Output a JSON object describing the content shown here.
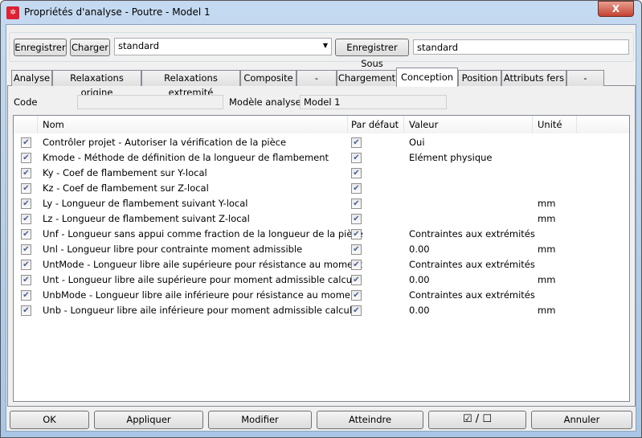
{
  "window": {
    "title": "Propriétés d'analyse - Poutre - Model 1",
    "close": "X"
  },
  "toolbar": {
    "save": "Enregistrer",
    "load": "Charger",
    "preset": "standard",
    "save_as": "Enregistrer Sous",
    "save_as_name": "standard"
  },
  "tabs": [
    "Analyse",
    "Relaxations origine",
    "Relaxations extremité",
    "Composite",
    "-",
    "Chargement",
    "Conception",
    "Position",
    "Attributs fers",
    "-"
  ],
  "selected_tab": "Conception",
  "form": {
    "code_label": "Code",
    "code_value": "",
    "model_label": "Modèle analyse",
    "model_value": "Model 1"
  },
  "table": {
    "headers": [
      "Nom",
      "Par défaut",
      "Valeur",
      "Unité"
    ],
    "rows": [
      {
        "checked": true,
        "name": "Contrôler projet - Autoriser la vérification de la pièce",
        "default": true,
        "value": "Oui",
        "unit": ""
      },
      {
        "checked": true,
        "name": "Kmode - Méthode de définition de la longueur de flambement",
        "default": true,
        "value": "Elément physique",
        "unit": ""
      },
      {
        "checked": true,
        "name": "Ky - Coef de flambement sur Y-local",
        "default": true,
        "value": "",
        "unit": ""
      },
      {
        "checked": true,
        "name": "Kz - Coef de flambement sur Z-local",
        "default": true,
        "value": "",
        "unit": ""
      },
      {
        "checked": true,
        "name": "Ly - Longueur de flambement suivant Y-local",
        "default": true,
        "value": "",
        "unit": "mm"
      },
      {
        "checked": true,
        "name": "Lz - Longueur de flambement suivant Z-local",
        "default": true,
        "value": "",
        "unit": "mm"
      },
      {
        "checked": true,
        "name": "Unf - Longueur sans appui comme fraction de la longueur de la pièce",
        "default": true,
        "value": "Contraintes aux extrémités",
        "unit": ""
      },
      {
        "checked": true,
        "name": "Unl - Longueur libre pour contrainte moment admissible",
        "default": true,
        "value": "0.00",
        "unit": "mm"
      },
      {
        "checked": true,
        "name": "UntMode - Longueur libre aile supérieure pour résistance au moment",
        "default": true,
        "value": "Contraintes aux extrémités",
        "unit": ""
      },
      {
        "checked": true,
        "name": "Unt - Longueur libre aile supérieure pour moment admissible calculé",
        "default": true,
        "value": "0.00",
        "unit": "mm"
      },
      {
        "checked": true,
        "name": "UnbMode - Longueur libre aile inférieure pour résistance au moment",
        "default": true,
        "value": "Contraintes aux extrémités",
        "unit": ""
      },
      {
        "checked": true,
        "name": "Unb - Longueur libre aile inférieure pour moment admissible calculé",
        "default": true,
        "value": "0.00",
        "unit": "mm"
      }
    ]
  },
  "buttons": {
    "ok": "OK",
    "apply": "Appliquer",
    "modify": "Modifier",
    "reach": "Atteindre",
    "toggle": "☑ / ☐",
    "cancel": "Annuler"
  }
}
